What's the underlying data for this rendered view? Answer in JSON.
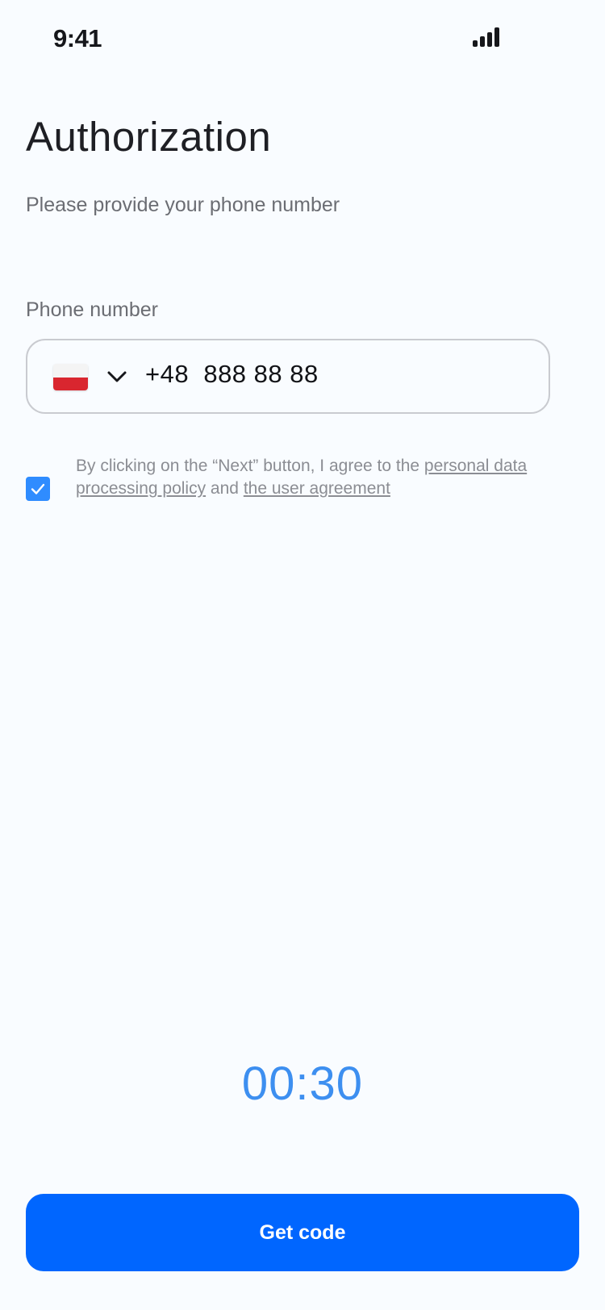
{
  "status_bar": {
    "time": "9:41",
    "signal_icon": "signal-icon"
  },
  "auth": {
    "title": "Authorization",
    "subtitle": "Please provide your phone number",
    "phone_label": "Phone number",
    "country_flag": "poland-flag-icon",
    "country_code": "+48",
    "phone_number": "888 88 88",
    "consent": {
      "checked": true,
      "text_before": "By clicking on the “Next” button, I agree to the ",
      "policy_link": "personal data processing policy",
      "text_middle": " and ",
      "agreement_link": "the user agreement"
    },
    "timer": "00:30",
    "submit_label": "Get code"
  },
  "colors": {
    "background": "#f9fcff",
    "primary": "#0066ff",
    "timer": "#3d8ff0",
    "checkbox": "#2f8cff"
  }
}
